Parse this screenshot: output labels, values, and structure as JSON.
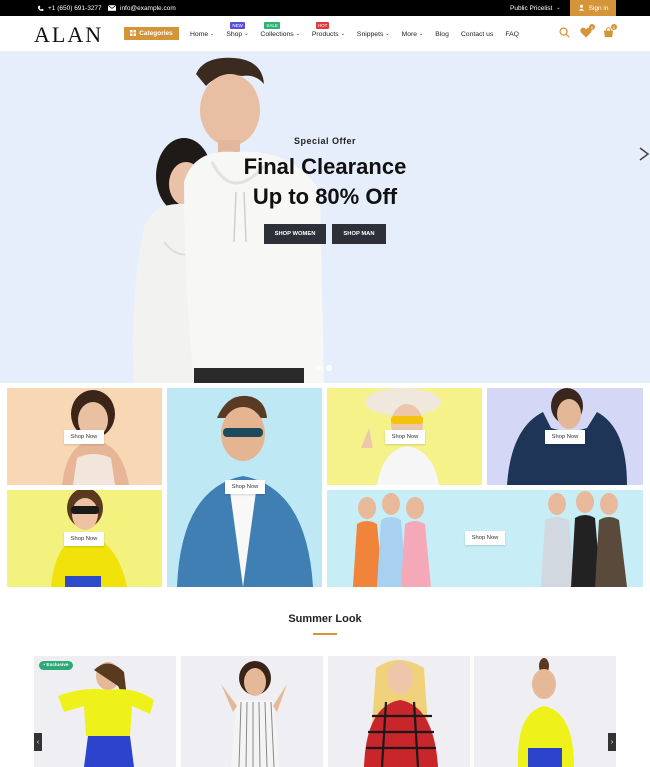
{
  "topbar": {
    "phone": "+1 (650) 691-3277",
    "email": "info@example.com",
    "pricelist": "Public Pricelist",
    "signin": "Sign in"
  },
  "header": {
    "logo": "ALAN",
    "categories_label": "Categories",
    "nav": [
      {
        "label": "Home",
        "dropdown": true,
        "badge": ""
      },
      {
        "label": "Shop",
        "dropdown": true,
        "badge": "NEW"
      },
      {
        "label": "Collections",
        "dropdown": true,
        "badge": "SALE"
      },
      {
        "label": "Products",
        "dropdown": true,
        "badge": "HOT"
      },
      {
        "label": "Snippets",
        "dropdown": true,
        "badge": ""
      },
      {
        "label": "More",
        "dropdown": true,
        "badge": ""
      },
      {
        "label": "Blog",
        "dropdown": false,
        "badge": ""
      },
      {
        "label": "Contact us",
        "dropdown": false,
        "badge": ""
      },
      {
        "label": "FAQ",
        "dropdown": false,
        "badge": ""
      }
    ],
    "badge_colors": {
      "NEW": "#5b4fd6",
      "SALE": "#2fb26f",
      "HOT": "#e0393e"
    },
    "icons": [
      "search-icon",
      "wishlist-icon",
      "cart-icon"
    ],
    "wishlist_count": "0",
    "cart_count": "0"
  },
  "hero": {
    "subtitle": "Special Offer",
    "title_line1": "Final Clearance",
    "title_line2": "Up to 80% Off",
    "btn_women": "SHOP WOMEN",
    "btn_man": "SHOP MAN",
    "slides": 2,
    "active_slide": 2
  },
  "tiles": {
    "shop_now": "Shop Now"
  },
  "section": {
    "title": "Summer Look",
    "exclusive_badge": "• Exclusive"
  },
  "colors": {
    "accent": "#d4953a",
    "dark_button": "#2d3038",
    "hero_bg": "#e6eefb"
  }
}
